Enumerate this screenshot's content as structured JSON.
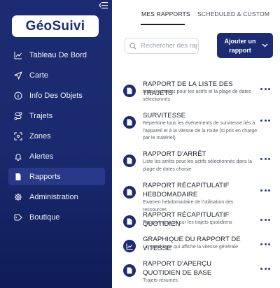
{
  "sidebar": {
    "logo_text": "GéoSuivi",
    "items": [
      {
        "label": "Tableau De Bord",
        "icon": "chart-line-icon",
        "active": false
      },
      {
        "label": "Carte",
        "icon": "navigation-arrow-icon",
        "active": false
      },
      {
        "label": "Info Des Objets",
        "icon": "info-icon",
        "active": false
      },
      {
        "label": "Trajets",
        "icon": "route-icon",
        "active": false
      },
      {
        "label": "Zones",
        "icon": "zones-icon",
        "active": false
      },
      {
        "label": "Alertes",
        "icon": "bell-icon",
        "active": false
      },
      {
        "label": "Rapports",
        "icon": "document-icon",
        "active": true
      },
      {
        "label": "Administration",
        "icon": "gear-icon",
        "active": false
      },
      {
        "label": "Boutique",
        "icon": "tag-icon",
        "active": false
      }
    ]
  },
  "tabs": [
    {
      "label": "MES RAPPORTS",
      "active": true
    },
    {
      "label": "SCHEDULED & CUSTOM",
      "active": false
    }
  ],
  "search": {
    "placeholder": "Rechercher des rapports",
    "value": ""
  },
  "add_button": {
    "label": "Ajouter un rapport"
  },
  "reports": [
    {
      "title": "RAPPORT DE LA LISTE DES TRAJETS",
      "description": "Liste les trajets pour les actifs et la plage de dates sélectionnés",
      "icon": "document-icon"
    },
    {
      "title": "SURVITESSE",
      "description": "Répertorie tous les événements de survitesse liés à l'appareil et à la vitesse de la route (si pris en charge par le matériel)",
      "icon": "document-icon"
    },
    {
      "title": "RAPPORT D'ARRÊT",
      "description": "Liste les arrêts pour les actifs sélectionnés dans la plage de dates choisie",
      "icon": "document-icon"
    },
    {
      "title": "RAPPORT RÉCAPITULATIF HEBDOMADAIRE",
      "description": "Examen hebdomadaire de l'utilisation des ressources",
      "icon": "document-icon"
    },
    {
      "title": "RAPPORT RÉCAPITULATIF QUOTIDIEN",
      "description": "Rapport résumé sur les trajets quotidiens",
      "icon": "document-icon"
    },
    {
      "title": "GRAPHIQUE DU RAPPORT DE VITESSE",
      "description": "Un graphique qui affiche la vitesse générale",
      "icon": "graph-icon"
    },
    {
      "title": "RAPPORT D'APERÇU QUOTIDIEN DE BASE",
      "description": "Trajets résumés",
      "icon": "document-icon"
    }
  ],
  "colors": {
    "sidebar": "#1d2c72",
    "accent": "#1d2c72",
    "active_item": "#28398a"
  }
}
